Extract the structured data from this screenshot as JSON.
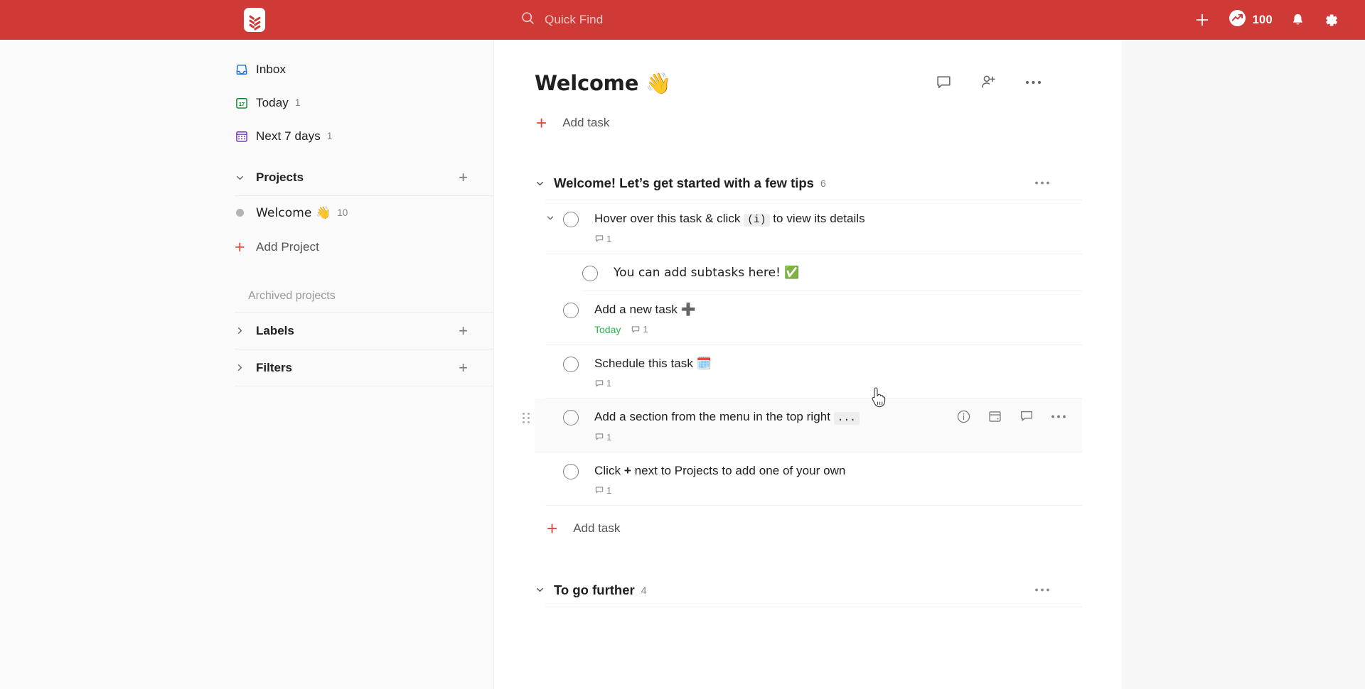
{
  "topbar": {
    "logo_icon": "todoist-logo-icon",
    "brand_color": "#cf3a37",
    "search_placeholder": "Quick Find",
    "search_icon": "search-icon",
    "add_icon": "plus-icon",
    "karma_icon": "productivity-trend-icon",
    "karma_value": "100",
    "notifications_icon": "bell-icon",
    "settings_icon": "gear-icon"
  },
  "sidebar": {
    "items": [
      {
        "label": "Inbox",
        "count": "",
        "icon": "inbox-icon",
        "color": "#246fe0"
      },
      {
        "label": "Today",
        "count": "1",
        "icon": "today-calendar-icon",
        "color": "#058527"
      },
      {
        "label": "Next 7 days",
        "count": "1",
        "icon": "upcoming-calendar-icon",
        "color": "#692fc2"
      }
    ],
    "projects": {
      "title": "Projects",
      "add_icon": "plus-icon",
      "chevron": "chevron-down-icon",
      "items": [
        {
          "label": "Welcome 👋",
          "count": "10",
          "dot_color": "#b3b3b3"
        }
      ],
      "add_project_label": "Add Project",
      "archived_label": "Archived projects"
    },
    "labels": {
      "title": "Labels",
      "chevron": "chevron-right-icon",
      "add_icon": "plus-icon"
    },
    "filters": {
      "title": "Filters",
      "chevron": "chevron-right-icon",
      "add_icon": "plus-icon"
    }
  },
  "main": {
    "title": "Welcome 👋",
    "header_actions": [
      {
        "name": "comments-icon"
      },
      {
        "name": "add-person-icon"
      },
      {
        "name": "more-menu-icon"
      }
    ],
    "add_task_top": "Add task",
    "add_task_bottom": "Add task",
    "sections": [
      {
        "title": "Welcome! Let’s get started with a few tips",
        "count": "6",
        "menu_icon": "section-more-icon",
        "tasks": [
          {
            "text_parts": [
              {
                "t": "Hover over this task & click ",
                "style": "plain"
              },
              {
                "t": "(i)",
                "style": "code"
              },
              {
                "t": " to view its details",
                "style": "plain"
              }
            ],
            "has_expand": true,
            "comments": "1",
            "date": "",
            "sub": false,
            "hovered": false
          },
          {
            "text_parts": [
              {
                "t": "You can add subtasks here! ✅",
                "style": "plain"
              }
            ],
            "has_expand": false,
            "comments": "",
            "date": "",
            "sub": true,
            "hovered": false
          },
          {
            "text_parts": [
              {
                "t": "Add a new task ",
                "style": "plain"
              },
              {
                "t": "➕",
                "style": "emoji"
              }
            ],
            "has_expand": false,
            "comments": "1",
            "date": "Today",
            "sub": false,
            "hovered": false
          },
          {
            "text_parts": [
              {
                "t": "Schedule this task ",
                "style": "plain"
              },
              {
                "t": "🗓️",
                "style": "emoji"
              }
            ],
            "has_expand": false,
            "comments": "1",
            "date": "",
            "sub": false,
            "hovered": false
          },
          {
            "text_parts": [
              {
                "t": "Add a section from the menu in the top right ",
                "style": "plain"
              },
              {
                "t": "...",
                "style": "code"
              }
            ],
            "has_expand": false,
            "comments": "1",
            "date": "",
            "sub": false,
            "hovered": true,
            "actions": [
              {
                "name": "task-info-icon"
              },
              {
                "name": "task-schedule-icon"
              },
              {
                "name": "task-comment-icon"
              },
              {
                "name": "task-more-icon"
              }
            ]
          },
          {
            "text_parts": [
              {
                "t": "Click ",
                "style": "plain"
              },
              {
                "t": "+",
                "style": "bold"
              },
              {
                "t": " next to Projects to add one of your own",
                "style": "plain"
              }
            ],
            "has_expand": false,
            "comments": "1",
            "date": "",
            "sub": false,
            "hovered": false
          }
        ]
      },
      {
        "title": "To go further",
        "count": "4",
        "menu_icon": "section-more-icon",
        "tasks": []
      }
    ]
  }
}
